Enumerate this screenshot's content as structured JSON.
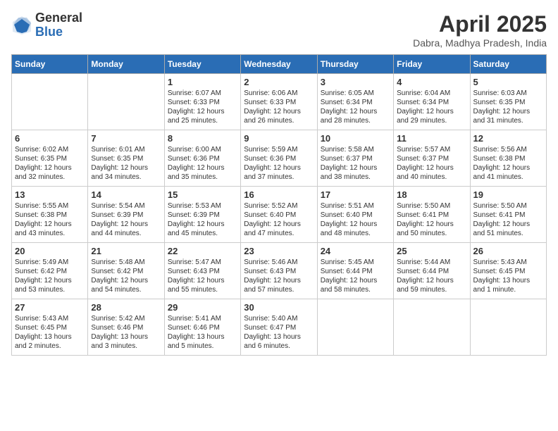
{
  "logo": {
    "general": "General",
    "blue": "Blue"
  },
  "title": {
    "month_year": "April 2025",
    "location": "Dabra, Madhya Pradesh, India"
  },
  "weekdays": [
    "Sunday",
    "Monday",
    "Tuesday",
    "Wednesday",
    "Thursday",
    "Friday",
    "Saturday"
  ],
  "weeks": [
    [
      {
        "day": "",
        "sunrise": "",
        "sunset": "",
        "daylight": ""
      },
      {
        "day": "",
        "sunrise": "",
        "sunset": "",
        "daylight": ""
      },
      {
        "day": "1",
        "sunrise": "Sunrise: 6:07 AM",
        "sunset": "Sunset: 6:33 PM",
        "daylight": "Daylight: 12 hours and 25 minutes."
      },
      {
        "day": "2",
        "sunrise": "Sunrise: 6:06 AM",
        "sunset": "Sunset: 6:33 PM",
        "daylight": "Daylight: 12 hours and 26 minutes."
      },
      {
        "day": "3",
        "sunrise": "Sunrise: 6:05 AM",
        "sunset": "Sunset: 6:34 PM",
        "daylight": "Daylight: 12 hours and 28 minutes."
      },
      {
        "day": "4",
        "sunrise": "Sunrise: 6:04 AM",
        "sunset": "Sunset: 6:34 PM",
        "daylight": "Daylight: 12 hours and 29 minutes."
      },
      {
        "day": "5",
        "sunrise": "Sunrise: 6:03 AM",
        "sunset": "Sunset: 6:35 PM",
        "daylight": "Daylight: 12 hours and 31 minutes."
      }
    ],
    [
      {
        "day": "6",
        "sunrise": "Sunrise: 6:02 AM",
        "sunset": "Sunset: 6:35 PM",
        "daylight": "Daylight: 12 hours and 32 minutes."
      },
      {
        "day": "7",
        "sunrise": "Sunrise: 6:01 AM",
        "sunset": "Sunset: 6:35 PM",
        "daylight": "Daylight: 12 hours and 34 minutes."
      },
      {
        "day": "8",
        "sunrise": "Sunrise: 6:00 AM",
        "sunset": "Sunset: 6:36 PM",
        "daylight": "Daylight: 12 hours and 35 minutes."
      },
      {
        "day": "9",
        "sunrise": "Sunrise: 5:59 AM",
        "sunset": "Sunset: 6:36 PM",
        "daylight": "Daylight: 12 hours and 37 minutes."
      },
      {
        "day": "10",
        "sunrise": "Sunrise: 5:58 AM",
        "sunset": "Sunset: 6:37 PM",
        "daylight": "Daylight: 12 hours and 38 minutes."
      },
      {
        "day": "11",
        "sunrise": "Sunrise: 5:57 AM",
        "sunset": "Sunset: 6:37 PM",
        "daylight": "Daylight: 12 hours and 40 minutes."
      },
      {
        "day": "12",
        "sunrise": "Sunrise: 5:56 AM",
        "sunset": "Sunset: 6:38 PM",
        "daylight": "Daylight: 12 hours and 41 minutes."
      }
    ],
    [
      {
        "day": "13",
        "sunrise": "Sunrise: 5:55 AM",
        "sunset": "Sunset: 6:38 PM",
        "daylight": "Daylight: 12 hours and 43 minutes."
      },
      {
        "day": "14",
        "sunrise": "Sunrise: 5:54 AM",
        "sunset": "Sunset: 6:39 PM",
        "daylight": "Daylight: 12 hours and 44 minutes."
      },
      {
        "day": "15",
        "sunrise": "Sunrise: 5:53 AM",
        "sunset": "Sunset: 6:39 PM",
        "daylight": "Daylight: 12 hours and 45 minutes."
      },
      {
        "day": "16",
        "sunrise": "Sunrise: 5:52 AM",
        "sunset": "Sunset: 6:40 PM",
        "daylight": "Daylight: 12 hours and 47 minutes."
      },
      {
        "day": "17",
        "sunrise": "Sunrise: 5:51 AM",
        "sunset": "Sunset: 6:40 PM",
        "daylight": "Daylight: 12 hours and 48 minutes."
      },
      {
        "day": "18",
        "sunrise": "Sunrise: 5:50 AM",
        "sunset": "Sunset: 6:41 PM",
        "daylight": "Daylight: 12 hours and 50 minutes."
      },
      {
        "day": "19",
        "sunrise": "Sunrise: 5:50 AM",
        "sunset": "Sunset: 6:41 PM",
        "daylight": "Daylight: 12 hours and 51 minutes."
      }
    ],
    [
      {
        "day": "20",
        "sunrise": "Sunrise: 5:49 AM",
        "sunset": "Sunset: 6:42 PM",
        "daylight": "Daylight: 12 hours and 53 minutes."
      },
      {
        "day": "21",
        "sunrise": "Sunrise: 5:48 AM",
        "sunset": "Sunset: 6:42 PM",
        "daylight": "Daylight: 12 hours and 54 minutes."
      },
      {
        "day": "22",
        "sunrise": "Sunrise: 5:47 AM",
        "sunset": "Sunset: 6:43 PM",
        "daylight": "Daylight: 12 hours and 55 minutes."
      },
      {
        "day": "23",
        "sunrise": "Sunrise: 5:46 AM",
        "sunset": "Sunset: 6:43 PM",
        "daylight": "Daylight: 12 hours and 57 minutes."
      },
      {
        "day": "24",
        "sunrise": "Sunrise: 5:45 AM",
        "sunset": "Sunset: 6:44 PM",
        "daylight": "Daylight: 12 hours and 58 minutes."
      },
      {
        "day": "25",
        "sunrise": "Sunrise: 5:44 AM",
        "sunset": "Sunset: 6:44 PM",
        "daylight": "Daylight: 12 hours and 59 minutes."
      },
      {
        "day": "26",
        "sunrise": "Sunrise: 5:43 AM",
        "sunset": "Sunset: 6:45 PM",
        "daylight": "Daylight: 13 hours and 1 minute."
      }
    ],
    [
      {
        "day": "27",
        "sunrise": "Sunrise: 5:43 AM",
        "sunset": "Sunset: 6:45 PM",
        "daylight": "Daylight: 13 hours and 2 minutes."
      },
      {
        "day": "28",
        "sunrise": "Sunrise: 5:42 AM",
        "sunset": "Sunset: 6:46 PM",
        "daylight": "Daylight: 13 hours and 3 minutes."
      },
      {
        "day": "29",
        "sunrise": "Sunrise: 5:41 AM",
        "sunset": "Sunset: 6:46 PM",
        "daylight": "Daylight: 13 hours and 5 minutes."
      },
      {
        "day": "30",
        "sunrise": "Sunrise: 5:40 AM",
        "sunset": "Sunset: 6:47 PM",
        "daylight": "Daylight: 13 hours and 6 minutes."
      },
      {
        "day": "",
        "sunrise": "",
        "sunset": "",
        "daylight": ""
      },
      {
        "day": "",
        "sunrise": "",
        "sunset": "",
        "daylight": ""
      },
      {
        "day": "",
        "sunrise": "",
        "sunset": "",
        "daylight": ""
      }
    ]
  ]
}
